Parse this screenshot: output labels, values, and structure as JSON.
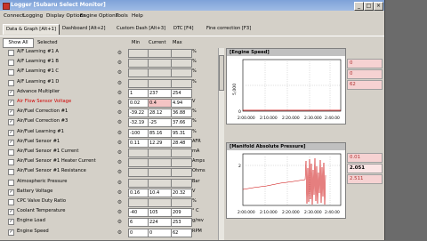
{
  "window": {
    "title": "Logger [Subaru Select Monitor]"
  },
  "menu": [
    "Connect",
    "Logging",
    "Display Options",
    "Engine Options",
    "Tools",
    "Help"
  ],
  "tabs": [
    "Data & Graph [Alt+1]",
    "Dashboard [Alt+2]",
    "Custom Dash [Alt+3]",
    "DTC [F4]",
    "Fine correction [F3]"
  ],
  "list_header": {
    "show_all": "Show All",
    "selected": "Selected",
    "min": "Min",
    "current": "Current",
    "max": "Max"
  },
  "rows": [
    {
      "name": "A/F Learning #1 A",
      "checked": false,
      "red": false,
      "min": "",
      "cur": "",
      "max": "",
      "unit": "%",
      "alert": false
    },
    {
      "name": "A/F Learning #1 B",
      "checked": false,
      "red": false,
      "min": "",
      "cur": "",
      "max": "",
      "unit": "%",
      "alert": false
    },
    {
      "name": "A/F Learning #1 C",
      "checked": false,
      "red": false,
      "min": "",
      "cur": "",
      "max": "",
      "unit": "%",
      "alert": false
    },
    {
      "name": "A/F Learning #1 D",
      "checked": false,
      "red": false,
      "min": "",
      "cur": "",
      "max": "",
      "unit": "%",
      "alert": false
    },
    {
      "name": "Advance Multiplier",
      "checked": true,
      "red": false,
      "min": "1",
      "cur": "237",
      "max": "254",
      "unit": "",
      "alert": false
    },
    {
      "name": "Air Flow Sensor Voltage",
      "checked": true,
      "red": true,
      "min": "0.02",
      "cur": "0.4",
      "max": "4.94",
      "unit": "V",
      "alert": true
    },
    {
      "name": "Air/Fuel Correction #1",
      "checked": true,
      "red": false,
      "min": "-39.22",
      "cur": "28.12",
      "max": "36.88",
      "unit": "%",
      "alert": false
    },
    {
      "name": "Air/Fuel Correction #3",
      "checked": true,
      "red": false,
      "min": "-32.19",
      "cur": "-25",
      "max": "37.66",
      "unit": "%",
      "alert": false
    },
    {
      "name": "Air/Fuel Learning #1",
      "checked": true,
      "red": false,
      "min": "-100",
      "cur": "85.16",
      "max": "95.31",
      "unit": "%",
      "alert": false
    },
    {
      "name": "Air/Fuel Sensor #1",
      "checked": true,
      "red": false,
      "min": "0.11",
      "cur": "12.29",
      "max": "28.48",
      "unit": "AFR",
      "alert": false
    },
    {
      "name": "Air/Fuel Sensor #1 Current",
      "checked": false,
      "red": false,
      "min": "",
      "cur": "",
      "max": "",
      "unit": "mA",
      "alert": false
    },
    {
      "name": "Air/Fuel Sensor #1 Heater Current",
      "checked": false,
      "red": false,
      "min": "",
      "cur": "",
      "max": "",
      "unit": "Amps",
      "alert": false
    },
    {
      "name": "Air/Fuel Sensor #1 Resistance",
      "checked": false,
      "red": false,
      "min": "",
      "cur": "",
      "max": "",
      "unit": "Ohms",
      "alert": false
    },
    {
      "name": "Atmospheric Pressure",
      "checked": false,
      "red": false,
      "min": "",
      "cur": "",
      "max": "",
      "unit": "Bar",
      "alert": false
    },
    {
      "name": "Battery Voltage",
      "checked": true,
      "red": false,
      "min": "0.16",
      "cur": "10.4",
      "max": "20.32",
      "unit": "V",
      "alert": false
    },
    {
      "name": "CPC Valve Duty Ratio",
      "checked": false,
      "red": false,
      "min": "",
      "cur": "",
      "max": "",
      "unit": "%",
      "alert": false
    },
    {
      "name": "Coolant Temperature",
      "checked": true,
      "red": false,
      "min": "-40",
      "cur": "105",
      "max": "209",
      "unit": "° C",
      "alert": false
    },
    {
      "name": "Engine Load",
      "checked": true,
      "red": false,
      "min": "6",
      "cur": "224",
      "max": "253",
      "unit": "g/rev",
      "alert": false
    },
    {
      "name": "Engine Speed",
      "checked": true,
      "red": false,
      "min": "0",
      "cur": "0",
      "max": "62",
      "unit": "RPM",
      "alert": false
    }
  ],
  "graphs": {
    "engine_speed": {
      "title": "[Engine Speed]",
      "ytick": "5,000",
      "yzero": "0",
      "xticks": [
        "2:00.000",
        "2:10.000",
        "2:20.000",
        "2:30.000",
        "2:40.00"
      ],
      "values": [
        "0",
        "0",
        "62"
      ]
    },
    "map": {
      "title": "[Manifold Absolute Pressure]",
      "ytick": "2",
      "xticks": [
        "2:00.000",
        "2:10.000",
        "2:20.000",
        "2:30.000",
        "2:40.00"
      ],
      "values": [
        "0.01",
        "2.051",
        "2.511"
      ]
    }
  }
}
